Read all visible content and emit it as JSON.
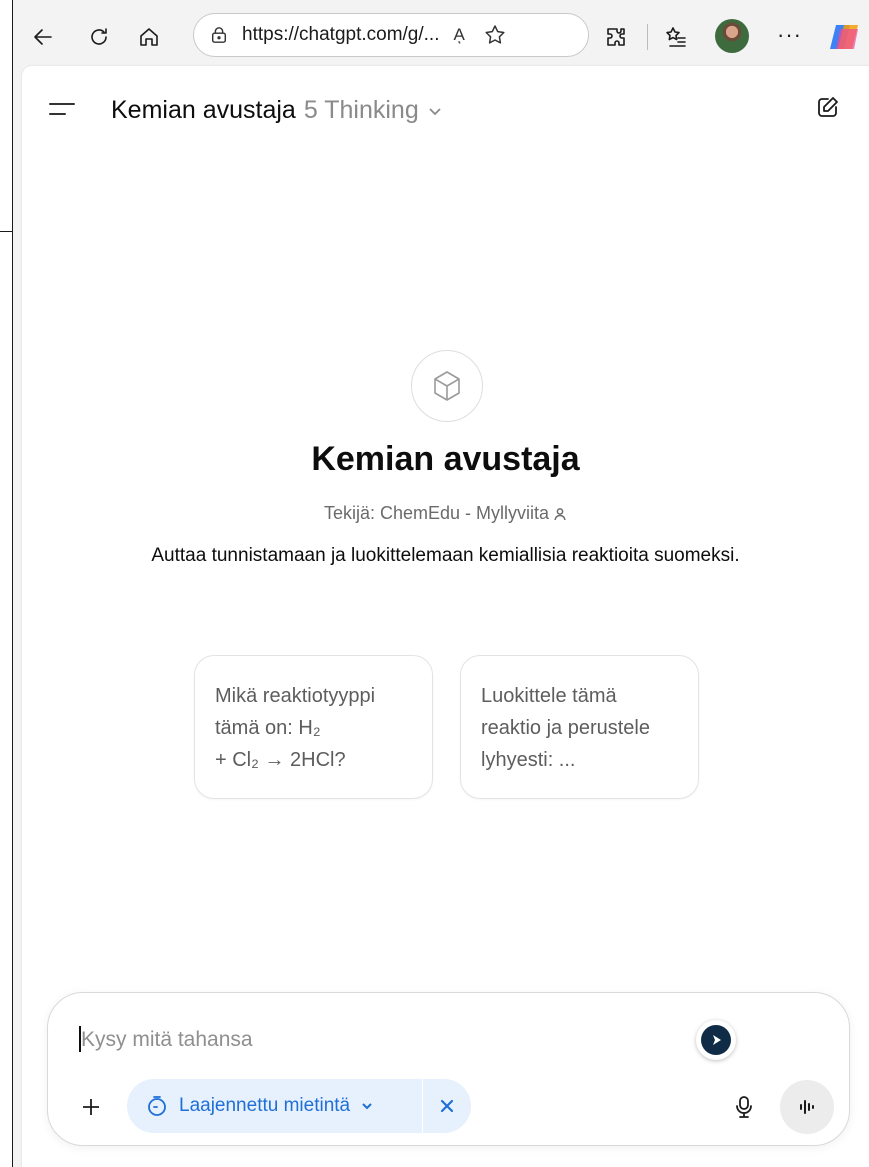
{
  "browser": {
    "url": "https://chatgpt.com/g/...",
    "read_aloud": "Aͅ",
    "icons": {
      "back": "back-arrow-icon",
      "refresh": "refresh-icon",
      "home": "home-icon",
      "lock": "lock-icon",
      "favorite": "star-icon",
      "extensions": "puzzle-icon",
      "favorites": "favorites-list-icon",
      "more": "more-dots-icon",
      "copilot": "copilot-icon"
    },
    "more_label": "···"
  },
  "header": {
    "gpt_name": "Kemian avustaja",
    "model": "5 Thinking"
  },
  "gpt": {
    "name": "Kemian avustaja",
    "author": "Tekijä: ChemEdu - Myllyviita",
    "description": "Auttaa tunnistamaan ja luokittelemaan kemiallisia reaktioita suomeksi."
  },
  "starters": [
    {
      "line1": "Mikä reaktiotyyppi",
      "line2": "tämä on: H₂",
      "line3": "+ Cl₂ → 2HCl?"
    },
    {
      "line1": "Luokittele tämä",
      "line2": "reaktio ja perustele",
      "line3": "lyhyesti: ..."
    }
  ],
  "composer": {
    "placeholder": "Kysy mitä tahansa",
    "mode_label": "Laajennettu mietintä"
  },
  "colors": {
    "accent": "#1f6fd6",
    "pill_bg": "#e6f1fd",
    "badge_bg": "#0f2b46"
  }
}
